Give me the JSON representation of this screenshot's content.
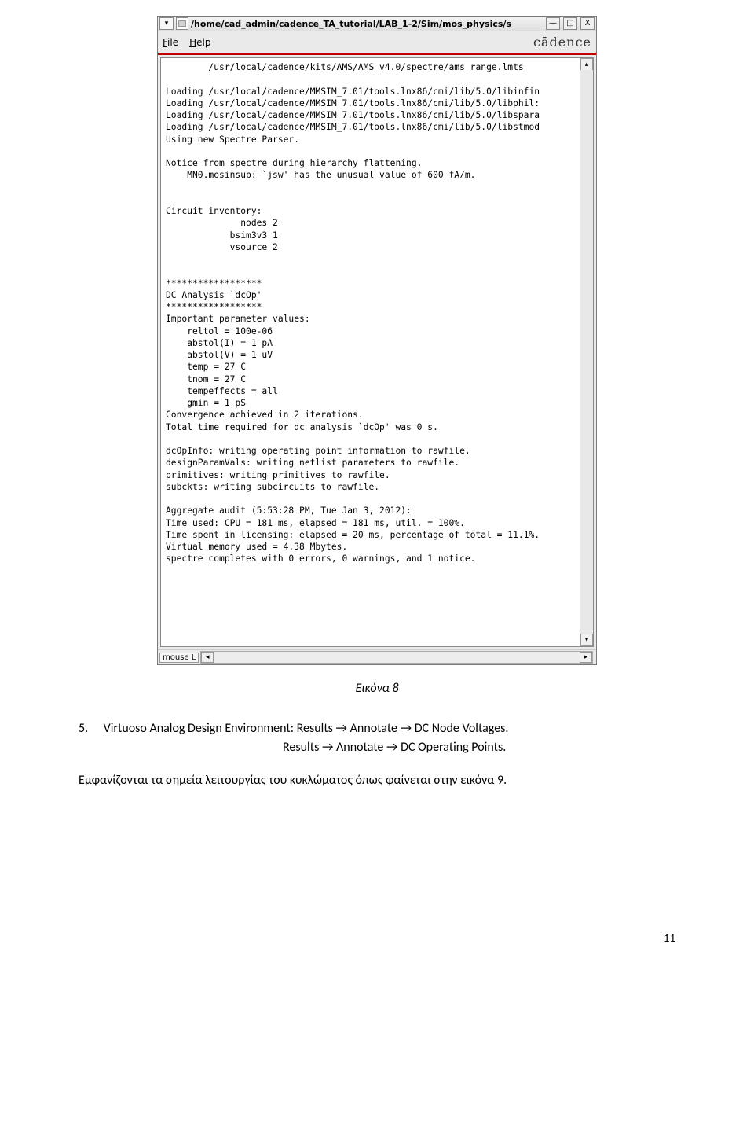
{
  "window": {
    "title": "/home/cad_admin/cadence_TA_tutorial/LAB_1-2/Sim/mos_physics/s",
    "menu": {
      "file": "File",
      "help": "Help",
      "brand": "cādence"
    },
    "win_buttons": {
      "min": "—",
      "max": "□",
      "close": "X"
    },
    "dropdown_glyph": "▾"
  },
  "console_lines": [
    "        /usr/local/cadence/kits/AMS/AMS_v4.0/spectre/ams_range.lmts",
    "",
    "Loading /usr/local/cadence/MMSIM_7.01/tools.lnx86/cmi/lib/5.0/libinfin",
    "Loading /usr/local/cadence/MMSIM_7.01/tools.lnx86/cmi/lib/5.0/libphil:",
    "Loading /usr/local/cadence/MMSIM_7.01/tools.lnx86/cmi/lib/5.0/libspara",
    "Loading /usr/local/cadence/MMSIM_7.01/tools.lnx86/cmi/lib/5.0/libstmod",
    "Using new Spectre Parser.",
    "",
    "Notice from spectre during hierarchy flattening.",
    "    MN0.mosinsub: `jsw' has the unusual value of 600 fA/m.",
    "",
    "",
    "Circuit inventory:",
    "              nodes 2",
    "            bsim3v3 1",
    "            vsource 2",
    "",
    "",
    "******************",
    "DC Analysis `dcOp'",
    "******************",
    "Important parameter values:",
    "    reltol = 100e-06",
    "    abstol(I) = 1 pA",
    "    abstol(V) = 1 uV",
    "    temp = 27 C",
    "    tnom = 27 C",
    "    tempeffects = all",
    "    gmin = 1 pS",
    "Convergence achieved in 2 iterations.",
    "Total time required for dc analysis `dcOp' was 0 s.",
    "",
    "dcOpInfo: writing operating point information to rawfile.",
    "designParamVals: writing netlist parameters to rawfile.",
    "primitives: writing primitives to rawfile.",
    "subckts: writing subcircuits to rawfile.",
    "",
    "Aggregate audit (5:53:28 PM, Tue Jan 3, 2012):",
    "Time used: CPU = 181 ms, elapsed = 181 ms, util. = 100%.",
    "Time spent in licensing: elapsed = 20 ms, percentage of total = 11.1%.",
    "Virtual memory used = 4.38 Mbytes.",
    "spectre completes with 0 errors, 0 warnings, and 1 notice.",
    ""
  ],
  "statusbar": {
    "mouse": "mouse L",
    "arrow_left": "◂",
    "arrow_right": "▸",
    "arrow_up": "▴",
    "arrow_down": "▾"
  },
  "caption": "Εικόνα 8",
  "instruction": {
    "num": "5.",
    "line1": "Virtuoso Analog Design Environment: Results → Annotate → DC Node Voltages.",
    "line2": "Results → Annotate → DC Operating Points."
  },
  "note": "Εμφανίζονται τα σημεία λειτουργίας του κυκλώματος όπως φαίνεται στην εικόνα 9.",
  "page_number": "11"
}
